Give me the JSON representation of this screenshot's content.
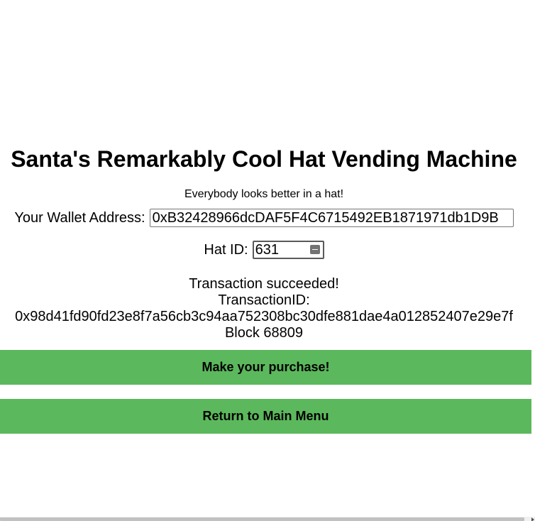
{
  "header": {
    "title": "Santa's Remarkably Cool Hat Vending Machine",
    "tagline": "Everybody looks better in a hat!"
  },
  "form": {
    "wallet_label": "Your Wallet Address:",
    "wallet_value": "0xB32428966dcDAF5F4C6715492EB1871971db1D9B",
    "hat_label": "Hat ID:",
    "hat_value": "631"
  },
  "status": {
    "message": "Transaction succeeded!",
    "txid_label": "TransactionID:",
    "txid_value": "0x98d41fd90fd23e8f7a56cb3c94aa752308bc30dfe881dae4a012852407e29e7f",
    "block": "Block 68809"
  },
  "buttons": {
    "purchase_label": "Make your purchase!",
    "menu_label": "Return to Main Menu"
  },
  "colors": {
    "button_bg": "#5cb85c"
  },
  "icons": {
    "hat_field": "number-spin-icon",
    "scroll": "scroll-right-arrow-icon"
  }
}
